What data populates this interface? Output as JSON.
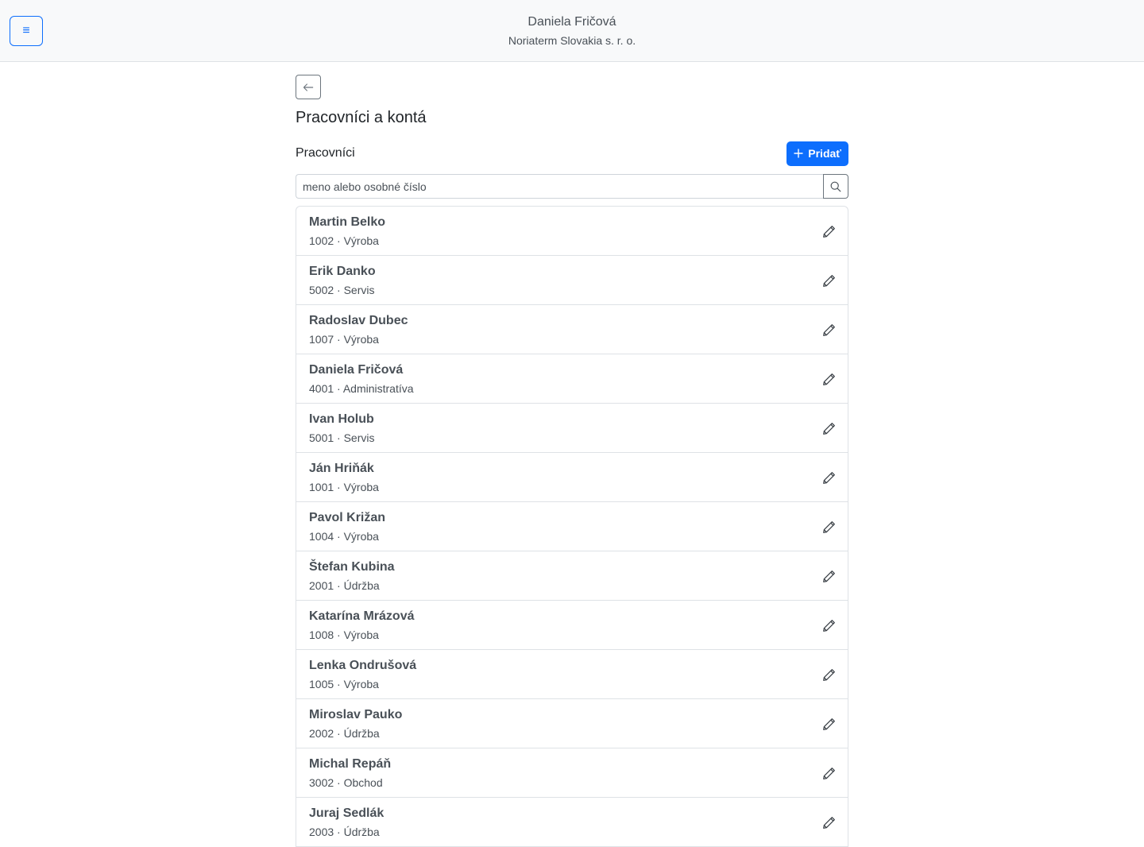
{
  "header": {
    "menu_glyph": "≡",
    "user_name": "Daniela Fričová",
    "company": "Noriaterm Slovakia s. r. o."
  },
  "page": {
    "title": "Pracovníci a kontá"
  },
  "workers": {
    "section_title": "Pracovníci",
    "add_label": "Pridať",
    "search_placeholder": "meno alebo osobné číslo",
    "items": [
      {
        "name": "Martin Belko",
        "sub": "1002 · Výroba"
      },
      {
        "name": "Erik Danko",
        "sub": "5002 · Servis"
      },
      {
        "name": "Radoslav Dubec",
        "sub": "1007 · Výroba"
      },
      {
        "name": "Daniela Fričová",
        "sub": "4001 · Administratíva"
      },
      {
        "name": "Ivan Holub",
        "sub": "5001 · Servis"
      },
      {
        "name": "Ján Hriňák",
        "sub": "1001 · Výroba"
      },
      {
        "name": "Pavol Križan",
        "sub": "1004 · Výroba"
      },
      {
        "name": "Štefan Kubina",
        "sub": "2001 · Údržba"
      },
      {
        "name": "Katarína Mrázová",
        "sub": "1008 · Výroba"
      },
      {
        "name": "Lenka Ondrušová",
        "sub": "1005 · Výroba"
      },
      {
        "name": "Miroslav Pauko",
        "sub": "2002 · Údržba"
      },
      {
        "name": "Michal Repáň",
        "sub": "3002 · Obchod"
      },
      {
        "name": "Juraj Sedlák",
        "sub": "2003 · Údržba"
      }
    ]
  },
  "colors": {
    "primary": "#0d6efd",
    "topbar_bg": "#f8f9fa",
    "border": "#dee2e6"
  }
}
